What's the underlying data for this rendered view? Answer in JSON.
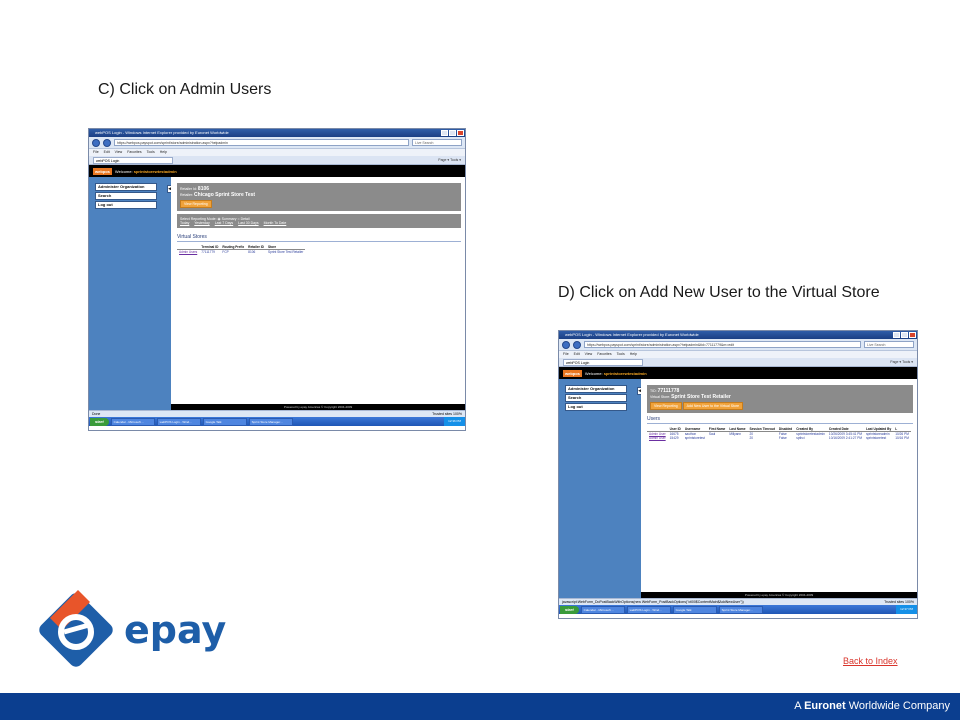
{
  "headings": {
    "c": "C) Click on Admin Users",
    "d": "D) Click on Add New User to the Virtual Store"
  },
  "shot_c": {
    "window_title": "webPOS Login - Windows Internet Explorer provided by Euronet Worldwide",
    "url": "https://webpos.payspot.com/sprint/store/administration.aspx?helpadmin",
    "search_placeholder": "Live Search",
    "menu": [
      "File",
      "Edit",
      "View",
      "Favorites",
      "Tools",
      "Help"
    ],
    "tab_label": "webPOS Login",
    "tools": "Page ▾  Tools ▾",
    "logo": "webpos",
    "welcome_prefix": "Welcome:",
    "welcome_user": "sprintstorewtestadmin",
    "nav_items": [
      "Administer Organization",
      "Search",
      "Log out"
    ],
    "retailer_id_label": "Retailer Id:",
    "retailer_id": "8106",
    "retailer_label": "Retailer:",
    "retailer_name": "Chicago Sprint Store Test",
    "view_reporting": "View Reporting",
    "reporting_mode": "Select Reporting Mode:  ◉ Summary  ○ Detail",
    "report_links": [
      "Today",
      "Yesterday",
      "Last 7 Days",
      "Last 30 Days",
      "Month To Date"
    ],
    "section_title": "Virtual Stores",
    "table_headers": [
      "",
      "Terminal ID",
      "Routing Prefix",
      "Retailer ID",
      "Store"
    ],
    "table_row": [
      "Admin Users",
      "77111779",
      "FCP",
      "8106",
      "Sprint Store Test Retailer"
    ],
    "powered_by": "Powered by epay Americas  © Copyright 2004-2009",
    "status_left": "Done",
    "status_right": "Trusted sites   100%",
    "start": "start",
    "tasks": [
      "Calendar - Microsoft ...",
      "webPOS Login - Wind...",
      "Google Talk",
      "Sprint Store Manager..."
    ],
    "clock": "12:36 PM"
  },
  "shot_d": {
    "window_title": "webPOS Login - Windows Internet Explorer provided by Euronet Worldwide",
    "url": "https://webpos.payspot.com/sprint/store/administration.aspx?helpadmin&tid=77111779&m=edit",
    "search_placeholder": "Live Search",
    "menu": [
      "File",
      "Edit",
      "View",
      "Favorites",
      "Tools",
      "Help"
    ],
    "tab_label": "webPOS Login",
    "tools": "Page ▾  Tools ▾",
    "logo": "webpos",
    "welcome_prefix": "Welcome:",
    "welcome_user": "sprintstorewtestadmin",
    "nav_items": [
      "Administer Organization",
      "Search",
      "Log out"
    ],
    "tid_label": "TID:",
    "tid": "77111778",
    "store_label": "Virtual Store:",
    "store_name": "Sprint Store Test Retailer",
    "view_reporting": "View Reporting",
    "add_user": "Add New User to the Virtual Store",
    "section_title": "Users",
    "table_headers": [
      "",
      "User ID",
      "Username",
      "First Name",
      "Last Name",
      "Session Timeout",
      "Disabled",
      "Created By",
      "Created Date",
      "Last Updated By",
      "L"
    ],
    "rows": [
      [
        "Admin User",
        "16675",
        "sauthon",
        "Saul",
        "Millyann",
        "20",
        "False",
        "sprintstoretestadmin",
        "10/26/2009 3:45:41 PM",
        "sprintstoreadmin",
        "10/26 PM"
      ],
      [
        "Admin User",
        "15429",
        "sprintstoretest",
        "",
        "",
        "20",
        "False",
        "spthci",
        "10/16/2009 2:41:27 PM",
        "sprintstoretest",
        "10/16 PM"
      ]
    ],
    "powered_by": "Powered by epay Americas  © Copyright 2004-2009",
    "status_left": "javascript:WebForm_DoPostBackWithOptions(new WebForm_PostBackOptions(\"ctl00$ContentMain$AddNewUser\"))",
    "status_right": "Trusted sites   100%",
    "start": "start",
    "tasks": [
      "Calendar - Microsoft ...",
      "webPOS Login - Wind...",
      "Google Talk",
      "Sprint Store Manager..."
    ],
    "clock": "12:37 PM"
  },
  "logo_text": "epay",
  "back_link": "Back to Index",
  "footer": {
    "prefix": "A ",
    "brand": "Euronet",
    "suffix": " Worldwide Company"
  },
  "colors": {
    "footer_bar": "#0b3e8f",
    "logo_orange": "#e8552a",
    "logo_blue": "#1e5ea8",
    "link_red": "#d9342b"
  }
}
